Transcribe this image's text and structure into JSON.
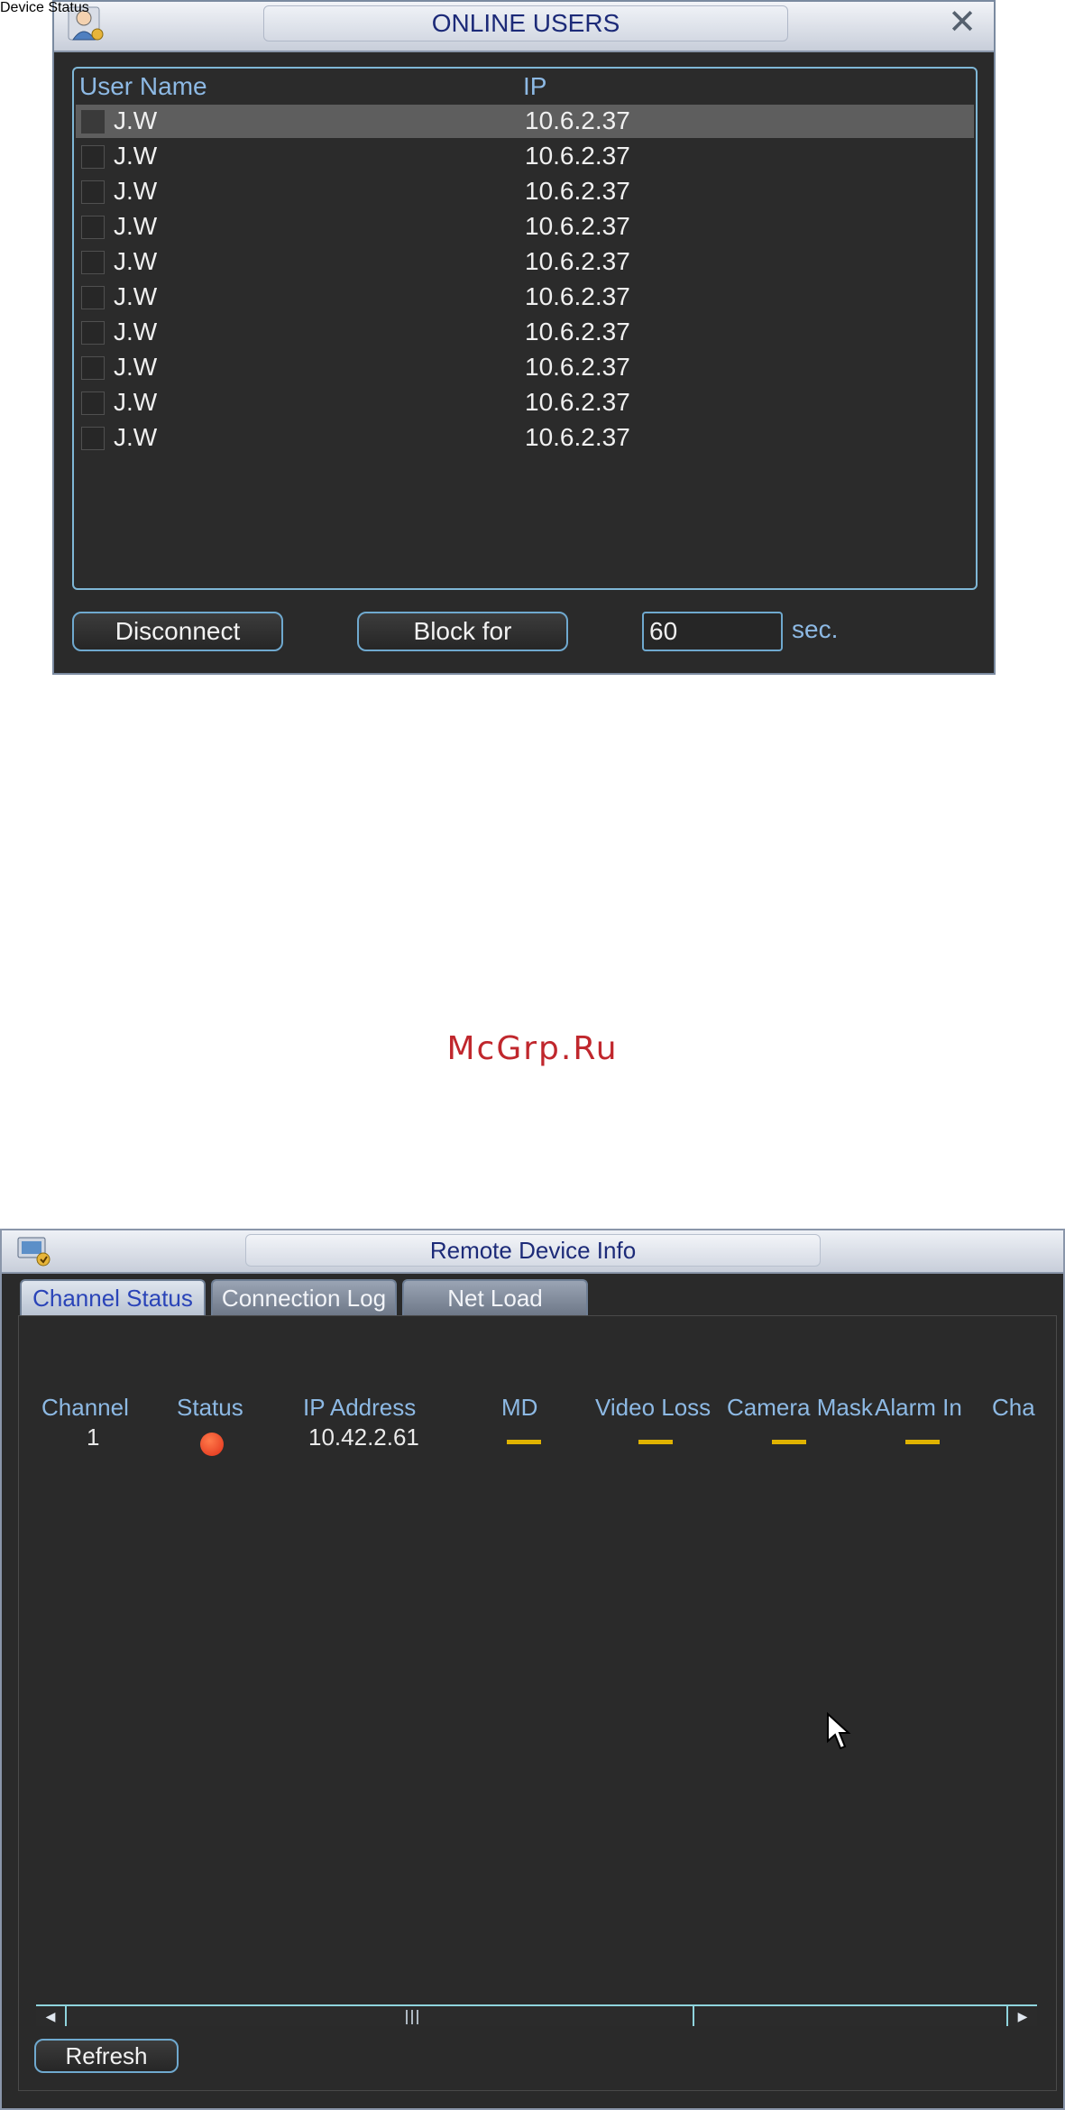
{
  "online_users": {
    "title": "ONLINE USERS",
    "columns": {
      "user_name": "User Name",
      "ip": "IP"
    },
    "rows": [
      {
        "user": "J.W",
        "ip": "10.6.2.37"
      },
      {
        "user": "J.W",
        "ip": "10.6.2.37"
      },
      {
        "user": "J.W",
        "ip": "10.6.2.37"
      },
      {
        "user": "J.W",
        "ip": "10.6.2.37"
      },
      {
        "user": "J.W",
        "ip": "10.6.2.37"
      },
      {
        "user": "J.W",
        "ip": "10.6.2.37"
      },
      {
        "user": "J.W",
        "ip": "10.6.2.37"
      },
      {
        "user": "J.W",
        "ip": "10.6.2.37"
      },
      {
        "user": "J.W",
        "ip": "10.6.2.37"
      },
      {
        "user": "J.W",
        "ip": "10.6.2.37"
      }
    ],
    "disconnect_label": "Disconnect",
    "block_label": "Block for",
    "block_seconds": "60",
    "seconds_unit": "sec.",
    "icons": {
      "title": "user-icon",
      "close": "close-icon"
    }
  },
  "watermark": "McGrp.Ru",
  "remote_device": {
    "title": "Remote Device Info",
    "tabs": [
      "Channel Status",
      "Connection Log",
      "Net Load"
    ],
    "active_tab": "Channel Status",
    "section_title": "Device Status",
    "columns": [
      "Channel",
      "Status",
      "IP Address",
      "MD",
      "Video Loss",
      "Camera Mask",
      "Alarm In",
      "Cha"
    ],
    "rows": [
      {
        "channel": "1",
        "status": "red-dot",
        "ip": "10.42.2.61",
        "md": "--",
        "video_loss": "--",
        "camera_mask": "--",
        "alarm_in": "--"
      }
    ],
    "refresh_label": "Refresh",
    "colors": {
      "status_dot": "#e0301a",
      "dash": "#e0b300",
      "accent": "#8db9e4"
    },
    "icons": {
      "title": "device-icon"
    }
  }
}
